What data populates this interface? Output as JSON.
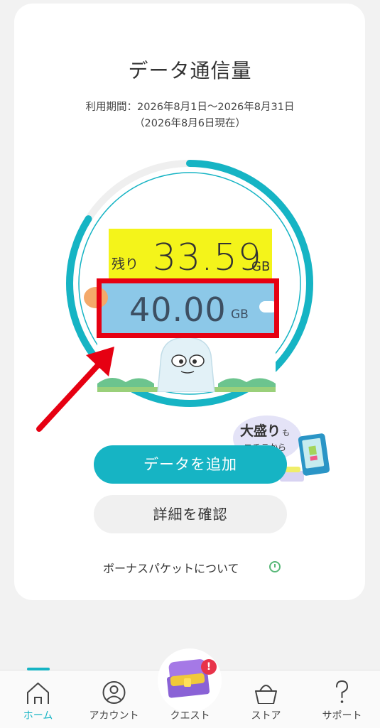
{
  "card": {
    "title": "データ通信量",
    "period": "利用期間：2026年8月1日〜2026年8月31日",
    "as_of": "（2026年8月6日現在）"
  },
  "usage": {
    "remain_label": "残り",
    "remain_value": "33.59",
    "remain_unit": "GB",
    "total_value": "40.00",
    "total_unit": "GB",
    "remaining_fraction": 0.84
  },
  "promo": {
    "main": "大盛り",
    "small": "も",
    "sub": "コチラから"
  },
  "buttons": {
    "add_data": "データを追加",
    "details": "詳細を確認"
  },
  "bonus": {
    "link": "ボーナスパケットについて",
    "icon": "info-icon"
  },
  "nav": {
    "items": [
      {
        "label": "ホーム",
        "icon": "home-icon",
        "active": true
      },
      {
        "label": "アカウント",
        "icon": "account-icon",
        "active": false
      },
      {
        "label": "クエスト",
        "icon": "treasure-chest-icon",
        "active": false
      },
      {
        "label": "ストア",
        "icon": "shopping-basket-icon",
        "active": false
      },
      {
        "label": "サポート",
        "icon": "question-icon",
        "active": false
      }
    ],
    "badge": "!"
  },
  "colors": {
    "accent": "#16b4c4",
    "highlight_yellow": "#f4f41a",
    "annotation_red": "#e60012",
    "card_bg": "#ffffff",
    "page_bg": "#f2f2f2"
  }
}
